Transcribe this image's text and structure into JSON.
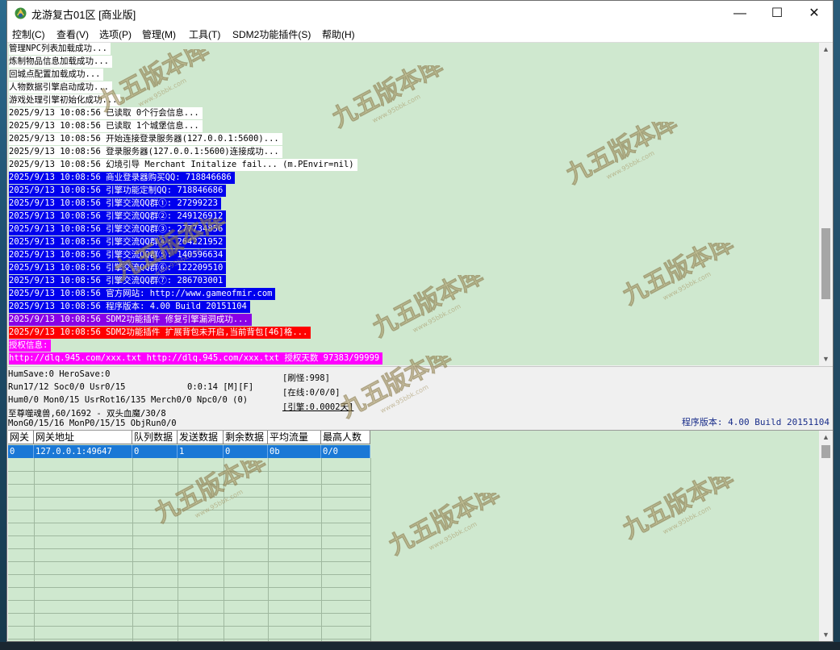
{
  "window": {
    "title": "龙游复古01区 [商业版]",
    "minimize_glyph": "—",
    "maximize_glyph": "☐",
    "close_glyph": "✕"
  },
  "menu": [
    "控制(C)",
    "查看(V)",
    "选项(P)",
    "管理(M)",
    "工具(T)",
    "SDM2功能插件(S)",
    "帮助(H)"
  ],
  "log_lines": [
    {
      "text": "管理NPC列表加载成功...",
      "style": "white"
    },
    {
      "text": "炼制物品信息加载成功...",
      "style": "white"
    },
    {
      "text": "回城点配置加载成功...",
      "style": "white"
    },
    {
      "text": "人物数据引擎启动成功...",
      "style": "white"
    },
    {
      "text": "游戏处理引擎初始化成功...",
      "style": "white"
    },
    {
      "text": "2025/9/13 10:08:56 已读取 0个行会信息...",
      "style": "white"
    },
    {
      "text": "2025/9/13 10:08:56 已读取 1个城堡信息...",
      "style": "white"
    },
    {
      "text": "2025/9/13 10:08:56 开始连接登录服务器(127.0.0.1:5600)...",
      "style": "white"
    },
    {
      "text": "2025/9/13 10:08:56 登录服务器(127.0.0.1:5600)连接成功...",
      "style": "white"
    },
    {
      "text": "2025/9/13 10:08:56 幻境引导 Merchant Initalize fail... (m.PEnvir=nil)",
      "style": "white"
    },
    {
      "text": "2025/9/13 10:08:56 商业登录器购买QQ: 718846686",
      "style": "blue"
    },
    {
      "text": "2025/9/13 10:08:56 引擎功能定制QQ: 718846686",
      "style": "blue"
    },
    {
      "text": "2025/9/13 10:08:56 引擎交流QQ群①: 27299223",
      "style": "blue"
    },
    {
      "text": "2025/9/13 10:08:56 引擎交流QQ群②: 249126912",
      "style": "blue"
    },
    {
      "text": "2025/9/13 10:08:56 引擎交流QQ群③: 277734856",
      "style": "blue"
    },
    {
      "text": "2025/9/13 10:08:56 引擎交流QQ群④: 264221952",
      "style": "blue"
    },
    {
      "text": "2025/9/13 10:08:56 引擎交流QQ群⑤: 140596634",
      "style": "blue"
    },
    {
      "text": "2025/9/13 10:08:56 引擎交流QQ群⑥: 122209510",
      "style": "blue"
    },
    {
      "text": "2025/9/13 10:08:56 引擎交流QQ群⑦: 286703001",
      "style": "blue"
    },
    {
      "text": "2025/9/13 10:08:56 官方网站: http://www.gameofmir.com",
      "style": "blue"
    },
    {
      "text": "2025/9/13 10:08:56 程序版本: 4.00 Build 20151104",
      "style": "blue"
    },
    {
      "text": "2025/9/13 10:08:56 SDM2功能插件 修复引擎漏洞成功...",
      "style": "purple"
    },
    {
      "text": "2025/9/13 10:08:56 SDM2功能插件 扩展背包未开启,当前背包[46]格...",
      "style": "red"
    },
    {
      "text": "授权信息:",
      "style": "magenta"
    },
    {
      "text": "http://dlq.945.com/xxx.txt http://dlq.945.com/xxx.txt 授权天数 97383/99999",
      "style": "magenta"
    }
  ],
  "status": {
    "line1": "HumSave:0 HeroSave:0",
    "line2": "Run17/12 Soc0/0 Usr0/15",
    "line3": "Hum0/0 Mon0/15 UsrRot16/135 Merch0/0 Npc0/0 (0)",
    "line4": "至尊噬魂兽,60/1692 - 双头血魔/30/8",
    "line5": "MonG0/15/16 MonP0/15/15 ObjRun0/0",
    "timer": "0:0:14 [M][F]",
    "refresh": "[刷怪:998]",
    "online": "[在线:0/0/0]",
    "engine": "[引擎:0.0002天]",
    "version": "程序版本: 4.00 Build 20151104"
  },
  "gate_table": {
    "columns": [
      "网关",
      "网关地址",
      "队列数据",
      "发送数据",
      "剩余数据",
      "平均流量",
      "最高人数"
    ],
    "rows": [
      [
        "0",
        "127.0.0.1:49647",
        "0",
        "1",
        "0",
        "0b",
        "0/0"
      ]
    ]
  },
  "watermark": {
    "text": "九五版本库",
    "sub": "www.95bbk.com"
  },
  "colors": {
    "panel_green": "#cfe8cf",
    "log_blue": "#0000ee",
    "log_red": "#ff0000",
    "log_magenta": "#ff00ff",
    "log_purple": "#8a00e6",
    "selection": "#1a78d6"
  }
}
